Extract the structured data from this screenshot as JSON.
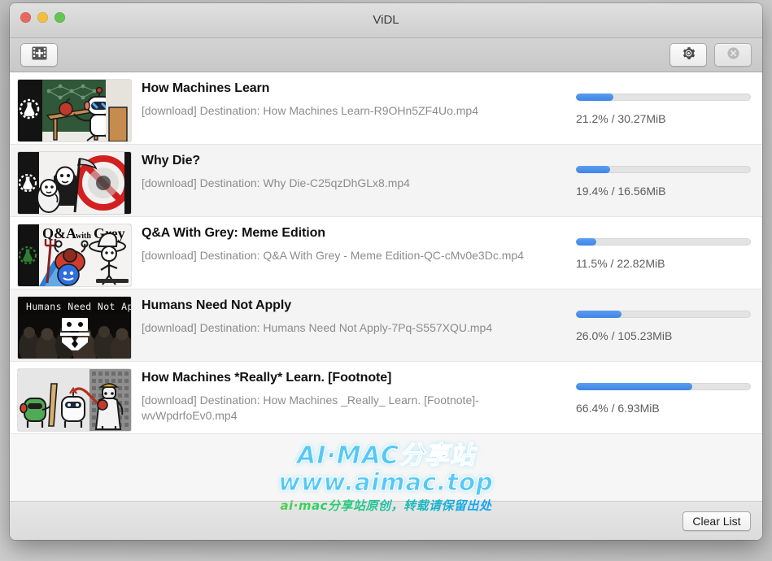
{
  "window": {
    "title": "ViDL",
    "traffic_lights": [
      {
        "name": "close",
        "color": "#e8685f"
      },
      {
        "name": "minimize",
        "color": "#f2bf41"
      },
      {
        "name": "zoom",
        "color": "#62c554"
      }
    ]
  },
  "toolbar": {
    "add_label": "add-video-icon",
    "settings_label": "gear-icon",
    "cancel_label": "cancel-icon"
  },
  "downloads": [
    {
      "title": "How Machines Learn",
      "destination": "[download] Destination: How Machines Learn-R9OHn5ZF4Uo.mp4",
      "percent": "21.2%",
      "size": "30.27MiB",
      "stat": "21.2% / 30.27MiB",
      "progress": 21.2,
      "thumb": "robot-teacher-chalkboard"
    },
    {
      "title": "Why Die?",
      "destination": "[download] Destination: Why Die-C25qzDhGLx8.mp4",
      "percent": "19.4%",
      "size": "16.56MiB",
      "stat": "19.4% / 16.56MiB",
      "progress": 19.4,
      "thumb": "grim-reaper-baby"
    },
    {
      "title": "Q&A With Grey: Meme Edition",
      "destination": "[download] Destination: Q&A With Grey - Meme Edition-QC-cMv0e3Dc.mp4",
      "percent": "11.5%",
      "size": "22.82MiB",
      "stat": "11.5% / 22.82MiB",
      "progress": 11.5,
      "thumb": "qa-with-grey"
    },
    {
      "title": "Humans Need Not Apply",
      "destination": "[download] Destination: Humans Need Not Apply-7Pq-S557XQU.mp4",
      "percent": "26.0%",
      "size": "105.23MiB",
      "stat": "26.0% / 105.23MiB",
      "progress": 26.0,
      "thumb": "humans-need-not-apply"
    },
    {
      "title": "How Machines *Really* Learn.  [Footnote]",
      "destination": "[download] Destination: How Machines _Really_ Learn.  [Footnote]-wvWpdrfoEv0.mp4",
      "percent": "66.4%",
      "size": "6.93MiB",
      "stat": "66.4% / 6.93MiB",
      "progress": 66.4,
      "thumb": "robots-lab"
    }
  ],
  "watermark": {
    "line1": "AI·MAC分享站",
    "line2": "www.aimac.top",
    "sub": "ai·mac分享站原创，转载请保留出处",
    "color": "#56c8f5"
  },
  "footer": {
    "clear_label": "Clear List"
  },
  "colors": {
    "progress_fill": "#3d85e8",
    "progress_track": "#e3e3e3",
    "title_text": "#111111",
    "dest_text": "#8c8c8c"
  }
}
